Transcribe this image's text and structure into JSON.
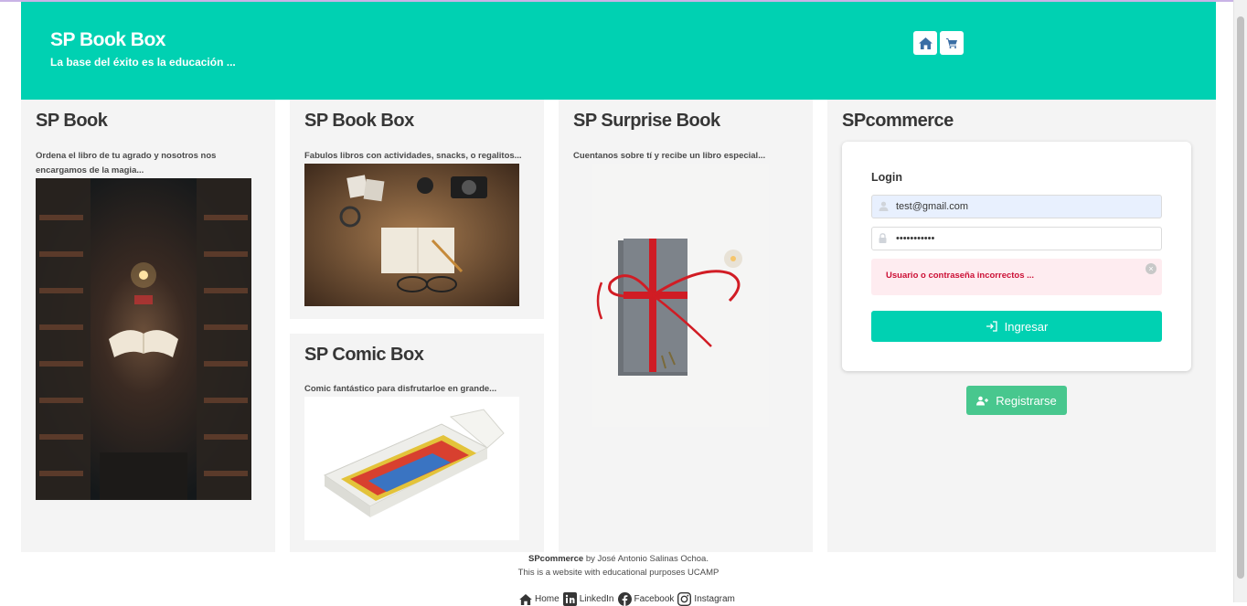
{
  "header": {
    "title": "SP Book Box",
    "subtitle": "La base del éxito es la educación ...",
    "nav": [
      {
        "icon": "home-icon"
      },
      {
        "icon": "cart-icon"
      }
    ]
  },
  "cards": [
    {
      "title": "SP Book",
      "description": "Ordena el libro de tu agrado y nosotros nos encargamos de la magia..."
    },
    {
      "title": "SP Book Box",
      "description": "Fabulos libros con actividades, snacks, o regalitos..."
    },
    {
      "title": "SP Comic Box",
      "description": "Comic fantástico para disfrutarloe en grande..."
    },
    {
      "title": "SP Surprise Book",
      "description": "Cuentanos sobre tí y recibe un libro especial..."
    }
  ],
  "login": {
    "section_title": "SPcommerce",
    "label": "Login",
    "email_value": "test@gmail.com",
    "password_value": "•••••••••••",
    "error": "Usuario o contraseña incorrectos ...",
    "submit_label": "Ingresar",
    "register_label": "Registrarse"
  },
  "footer": {
    "brand": "SPcommerce",
    "author": " by José Antonio Salinas Ochoa.",
    "note": "This is a website with educational purposes UCAMP",
    "links": [
      "Home",
      "LinkedIn",
      "Facebook",
      "Instagram"
    ]
  },
  "colors": {
    "primary": "#00d1b2",
    "success": "#48c78e",
    "danger": "#cc0f35",
    "danger_bg": "#feecf0"
  }
}
